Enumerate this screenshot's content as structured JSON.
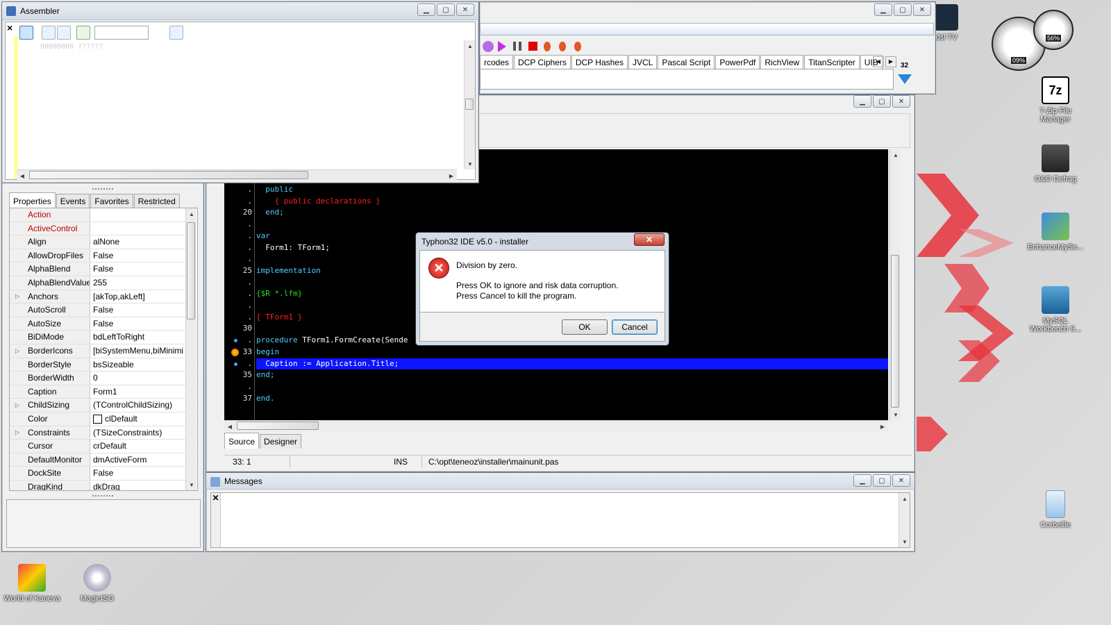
{
  "assembler": {
    "title": "Assembler",
    "close_label": "×",
    "address_line": "00000000  ??????"
  },
  "object_inspector": {
    "tabs": [
      "Properties",
      "Events",
      "Favorites",
      "Restricted"
    ],
    "properties": [
      {
        "name": "Action",
        "value": "",
        "expandable": false,
        "highlight": true
      },
      {
        "name": "ActiveControl",
        "value": "",
        "expandable": false,
        "highlight": true
      },
      {
        "name": "Align",
        "value": "alNone",
        "expandable": false,
        "highlight": false
      },
      {
        "name": "AllowDropFiles",
        "value": "False",
        "expandable": false,
        "highlight": false
      },
      {
        "name": "AlphaBlend",
        "value": "False",
        "expandable": false,
        "highlight": false
      },
      {
        "name": "AlphaBlendValue",
        "value": "255",
        "expandable": false,
        "highlight": false
      },
      {
        "name": "Anchors",
        "value": "[akTop,akLeft]",
        "expandable": true,
        "highlight": false
      },
      {
        "name": "AutoScroll",
        "value": "False",
        "expandable": false,
        "highlight": false
      },
      {
        "name": "AutoSize",
        "value": "False",
        "expandable": false,
        "highlight": false
      },
      {
        "name": "BiDiMode",
        "value": "bdLeftToRight",
        "expandable": false,
        "highlight": false
      },
      {
        "name": "BorderIcons",
        "value": "[biSystemMenu,biMinimi",
        "expandable": true,
        "highlight": false
      },
      {
        "name": "BorderStyle",
        "value": "bsSizeable",
        "expandable": false,
        "highlight": false
      },
      {
        "name": "BorderWidth",
        "value": "0",
        "expandable": false,
        "highlight": false
      },
      {
        "name": "Caption",
        "value": "Form1",
        "expandable": false,
        "highlight": false
      },
      {
        "name": "ChildSizing",
        "value": "(TControlChildSizing)",
        "expandable": true,
        "highlight": false
      },
      {
        "name": "Color",
        "value": "clDefault",
        "expandable": false,
        "highlight": false
      },
      {
        "name": "Constraints",
        "value": "(TSizeConstraints)",
        "expandable": true,
        "highlight": false
      },
      {
        "name": "Cursor",
        "value": "crDefault",
        "expandable": false,
        "highlight": false
      },
      {
        "name": "DefaultMonitor",
        "value": "dmActiveForm",
        "expandable": false,
        "highlight": false
      },
      {
        "name": "DockSite",
        "value": "False",
        "expandable": false,
        "highlight": false
      },
      {
        "name": "DragKind",
        "value": "dkDrag",
        "expandable": false,
        "highlight": false
      }
    ]
  },
  "ide_main": {
    "palette_tabs": [
      "rcodes",
      "DCP Ciphers",
      "DCP Hashes",
      "JVCL",
      "Pascal Script",
      "PowerPdf",
      "RichView",
      "TitanScripter",
      "UIB"
    ],
    "palette_count": "32"
  },
  "editor": {
    "gutter": [
      {
        "num": ".",
        "mark": ""
      },
      {
        "num": ".",
        "mark": ""
      },
      {
        "num": "20",
        "mark": ""
      },
      {
        "num": ".",
        "mark": ""
      },
      {
        "num": ".",
        "mark": ""
      },
      {
        "num": ".",
        "mark": ""
      },
      {
        "num": ".",
        "mark": ""
      },
      {
        "num": "25",
        "mark": ""
      },
      {
        "num": ".",
        "mark": ""
      },
      {
        "num": ".",
        "mark": ""
      },
      {
        "num": ".",
        "mark": ""
      },
      {
        "num": ".",
        "mark": ""
      },
      {
        "num": "30",
        "mark": ""
      },
      {
        "num": ".",
        "mark": "dot"
      },
      {
        "num": "33",
        "mark": "bp"
      },
      {
        "num": ".",
        "mark": "dot"
      },
      {
        "num": "35",
        "mark": ""
      },
      {
        "num": ".",
        "mark": ""
      },
      {
        "num": "37",
        "mark": ""
      }
    ],
    "lines": [
      [
        {
          "t": "  public",
          "c": "kw"
        }
      ],
      [
        {
          "t": "    { public declarations }",
          "c": "cm"
        }
      ],
      [
        {
          "t": "  end;",
          "c": "kw"
        }
      ],
      [
        {
          "t": "",
          "c": "wt"
        }
      ],
      [
        {
          "t": "var",
          "c": "kw"
        }
      ],
      [
        {
          "t": "  Form1: TForm1;",
          "c": "wt"
        }
      ],
      [
        {
          "t": "",
          "c": "wt"
        }
      ],
      [
        {
          "t": "implementation",
          "c": "kw"
        }
      ],
      [
        {
          "t": "",
          "c": "wt"
        }
      ],
      [
        {
          "t": "{$R *.lfm}",
          "c": "gn"
        }
      ],
      [
        {
          "t": "",
          "c": "wt"
        }
      ],
      [
        {
          "t": "{ TForm1 }",
          "c": "cm"
        }
      ],
      [
        {
          "t": "",
          "c": "wt"
        }
      ],
      [
        {
          "t": "procedure",
          "c": "kw"
        },
        {
          "t": " TForm1.FormCreate(Sende",
          "c": "wt"
        }
      ],
      [
        {
          "t": "begin",
          "c": "kw"
        }
      ],
      [
        {
          "t": "  Caption := Application.Title;",
          "c": "wt"
        }
      ],
      [
        {
          "t": "end;",
          "c": "kw"
        }
      ],
      [
        {
          "t": "",
          "c": "wt"
        }
      ],
      [
        {
          "t": "end.",
          "c": "kw"
        }
      ]
    ],
    "highlight_line": 15,
    "tabs": [
      "Source",
      "Designer"
    ],
    "status": {
      "pos": "33:  1",
      "mode": "INS",
      "file": "C:\\opt\\teneoz\\installer\\mainunit.pas"
    }
  },
  "messages": {
    "title": "Messages"
  },
  "dialog": {
    "title": "Typhon32 IDE v5.0 - installer",
    "message_line1": "Division by zero.",
    "message_line2": "Press OK to ignore and risk data corruption.",
    "message_line3": "Press Cancel to kill the program.",
    "ok_label": "OK",
    "cancel_label": "Cancel"
  },
  "desktop_icons": {
    "zip": "7-Zip File Manager",
    "oo": "O&O Defrag",
    "enhance": "EnhanceMySe...",
    "mysql": "MySQL Workbench 5...",
    "trash": "Corbeille",
    "kaneva": "World of Kaneva",
    "magiciso": "MagicISO",
    "adsl": "adsl TV"
  },
  "gauge": {
    "cpu": "09%",
    "mem": "56%"
  }
}
